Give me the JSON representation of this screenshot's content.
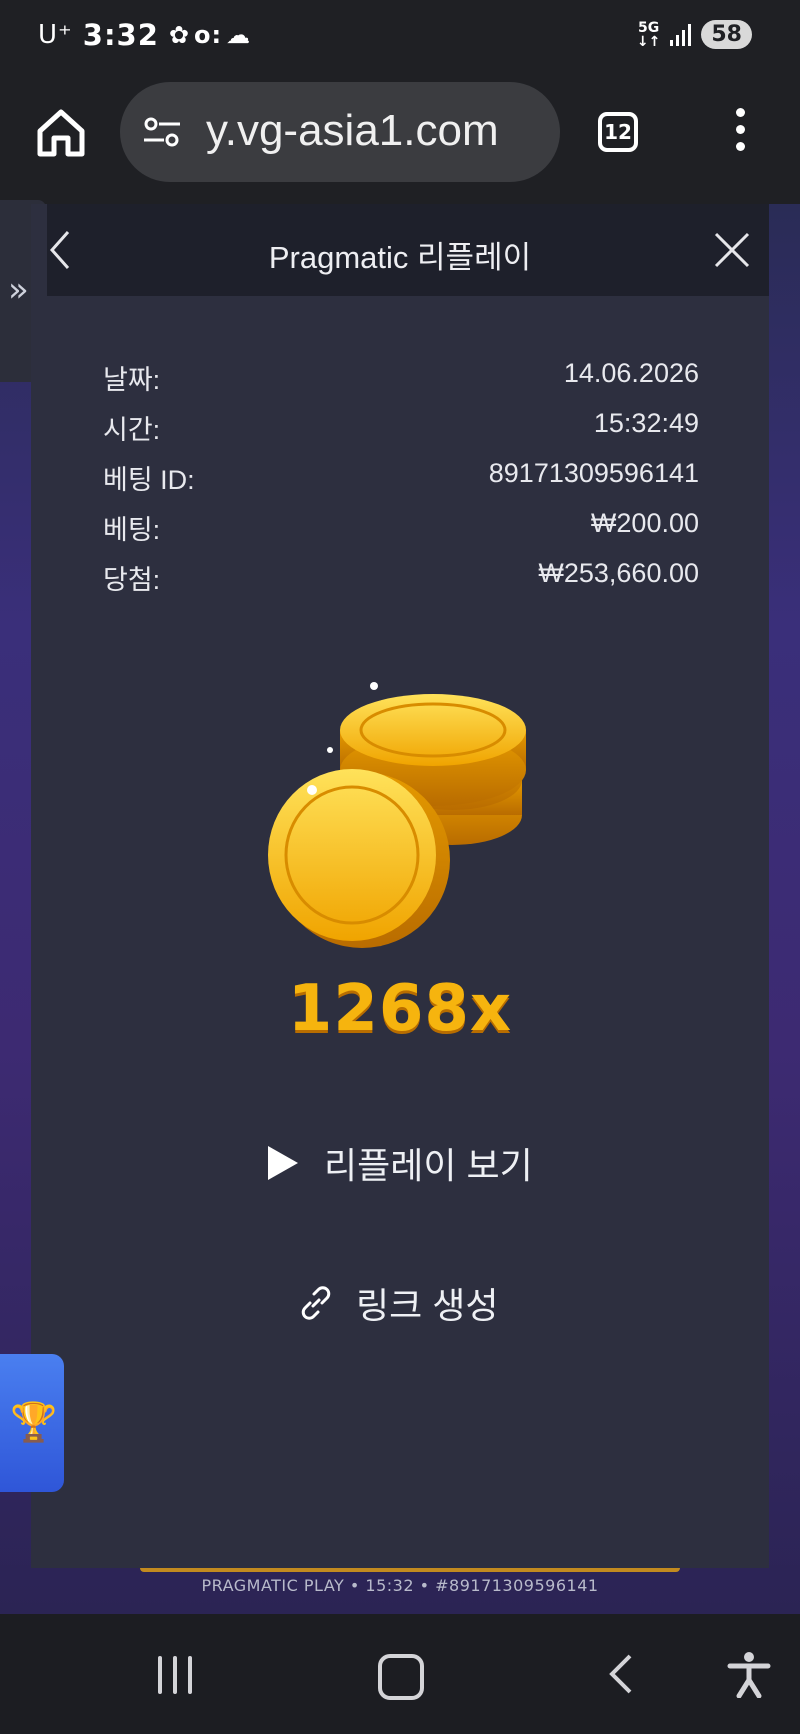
{
  "status_bar": {
    "carrier": "U⁺",
    "time": "3:32",
    "network": "5G",
    "battery": "58"
  },
  "browser": {
    "url": "y.vg-asia1.com",
    "tab_count": "12"
  },
  "modal": {
    "title": "Pragmatic 리플레이",
    "info": [
      {
        "label": "날짜:",
        "value": "14.06.2026"
      },
      {
        "label": "시간:",
        "value": "15:32:49"
      },
      {
        "label": "베팅 ID:",
        "value": "89171309596141"
      },
      {
        "label": "베팅:",
        "value": "₩200.00"
      },
      {
        "label": "당첨:",
        "value": "₩253,660.00"
      }
    ],
    "multiplier": "1268x",
    "replay_label": "리플레이 보기",
    "link_label": "링크 생성"
  },
  "background": {
    "caption": "PRAGMATIC PLAY • 15:32 • #89171309596141"
  },
  "colors": {
    "accent_gold": "#f6b40e",
    "modal_bg": "#2d2f3f",
    "header_bg": "#1e202b"
  }
}
